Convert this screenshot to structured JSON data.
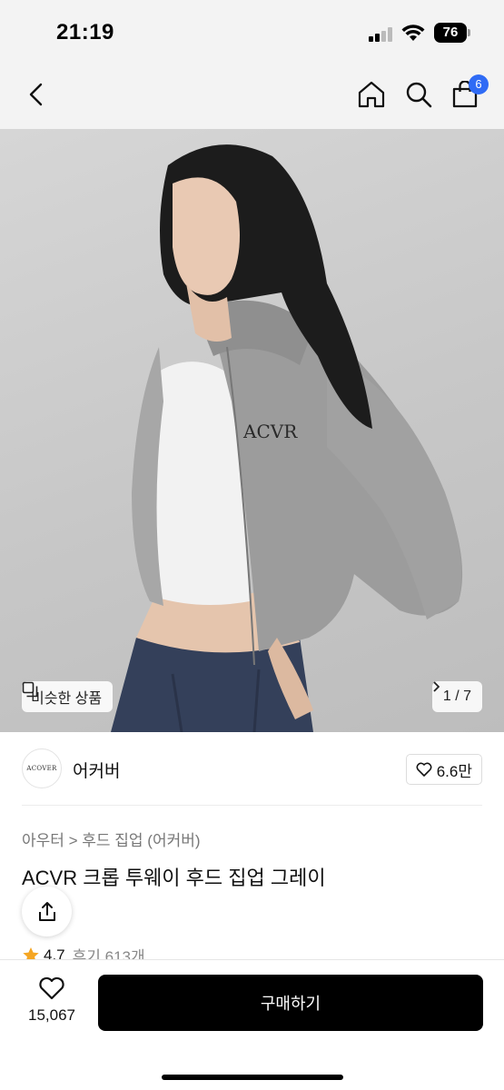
{
  "status_bar": {
    "time": "21:19",
    "battery": "76"
  },
  "nav": {
    "cart_count": "6"
  },
  "hero": {
    "similar_label": "비슷한 상품",
    "page_indicator": "1 / 7",
    "print_text": "ACVR"
  },
  "brand": {
    "logo_text": "ACOVER",
    "name": "어커버",
    "likes": "6.6만"
  },
  "product": {
    "category": "아우터 > 후드 집업 (어커버)",
    "title": "ACVR 크롭 투웨이 후드 집업 그레이",
    "rating": "4.7",
    "reviews": "후기 613개"
  },
  "bottom": {
    "wish_count": "15,067",
    "buy_label": "구매하기"
  },
  "colors": {
    "badge": "#2f6bf5",
    "star": "#f5a623",
    "buy_button": "#000000"
  }
}
